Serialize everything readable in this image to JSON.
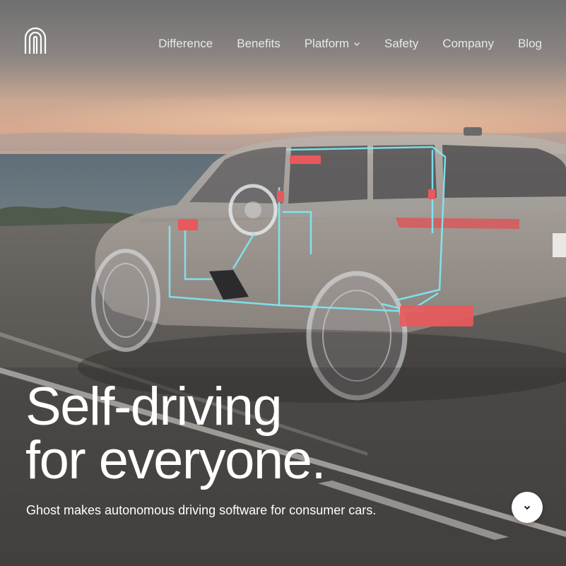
{
  "brand": {
    "logo_icon": "ghost-arch-logo-icon"
  },
  "nav": {
    "items": [
      {
        "label": "Difference"
      },
      {
        "label": "Benefits"
      },
      {
        "label": "Platform",
        "has_dropdown": true,
        "icon": "chevron-down-icon"
      },
      {
        "label": "Safety"
      },
      {
        "label": "Company"
      },
      {
        "label": "Blog"
      }
    ]
  },
  "hero": {
    "headline_line1": "Self-driving",
    "headline_line2": "for everyone.",
    "subtitle": "Ghost makes autonomous driving software for consumer cars.",
    "scroll_button_icon": "chevron-down-icon"
  },
  "colors": {
    "text": "#ffffff",
    "accent_wire": "#7fe9f5",
    "accent_hardware": "#e8595b"
  }
}
